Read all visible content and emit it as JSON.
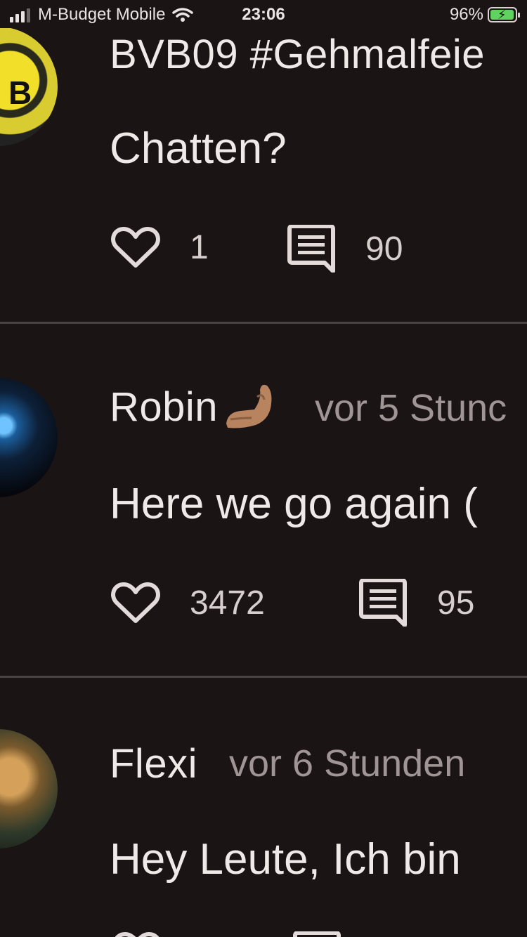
{
  "status_bar": {
    "carrier": "M-Budget Mobile",
    "time": "23:06",
    "battery": "96%",
    "battery_level": 0.96
  },
  "posts": [
    {
      "author": "BVB09 #Gehmalfeie",
      "time": "",
      "text": "Chatten?",
      "likes": "1",
      "comments": "90"
    },
    {
      "author": "Robin",
      "time": "vor 5 Stunc",
      "text": "Here we go again (",
      "likes": "3472",
      "comments": "95"
    },
    {
      "author": "Flexi",
      "time": "vor 6 Stunden",
      "text": "Hey Leute, Ich bin",
      "likes": "",
      "comments": ""
    }
  ],
  "icons": {
    "like": "heart-outline-icon",
    "comment": "comment-bubble-icon",
    "emoji": "pinched-fingers-emoji"
  }
}
